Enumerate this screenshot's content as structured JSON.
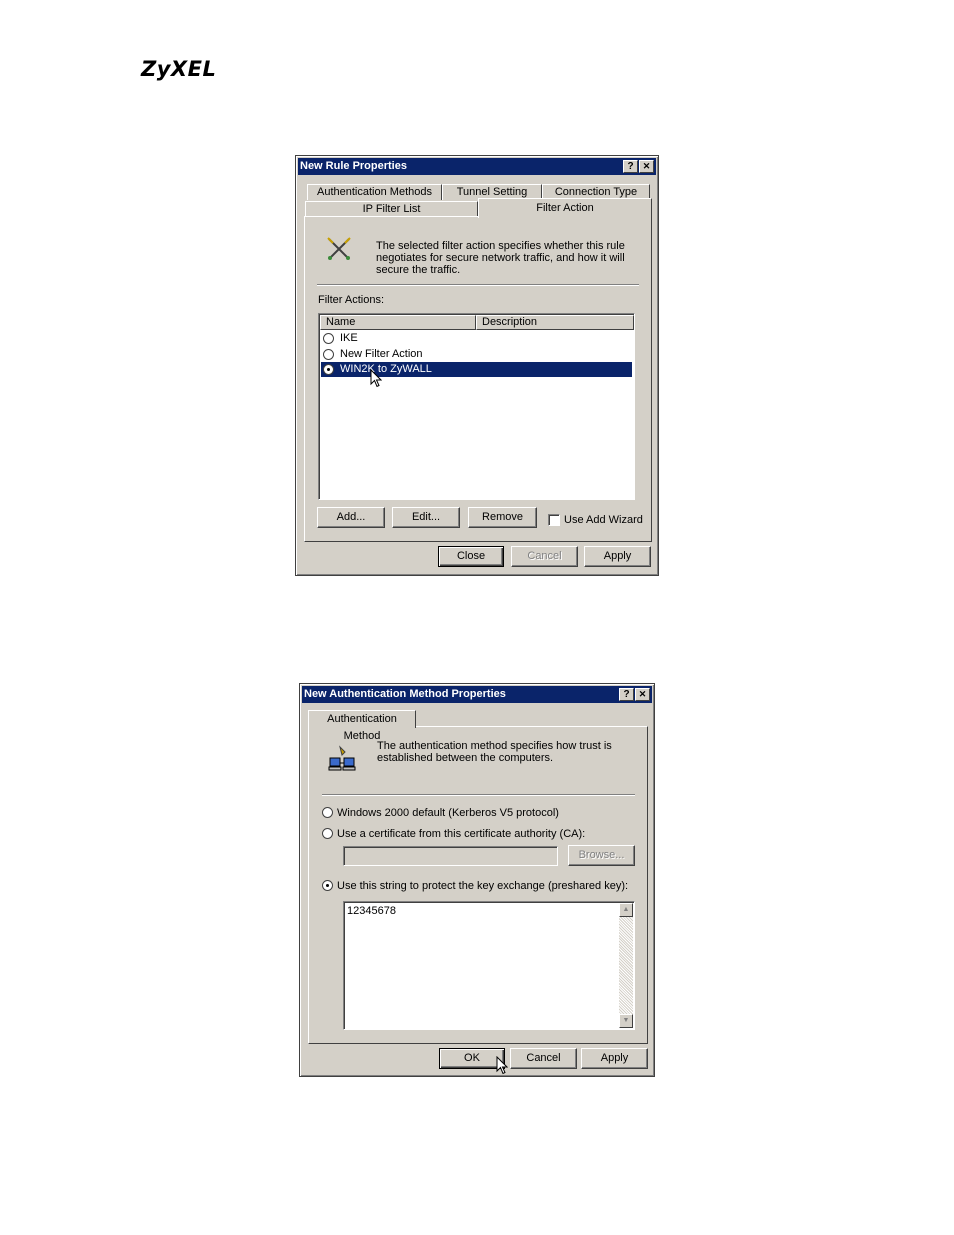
{
  "logo": "ZyXEL",
  "rule_dialog": {
    "title": "New Rule Properties",
    "help_btn": "?",
    "close_btn": "✕",
    "tabs": [
      "Authentication Methods",
      "Tunnel Setting",
      "Connection Type",
      "IP Filter List",
      "Filter Action"
    ],
    "description": "The selected filter action specifies whether this rule negotiates for secure network traffic, and how it will secure the traffic.",
    "filter_actions_label": "Filter Actions:",
    "columns": [
      "Name",
      "Description"
    ],
    "rows": [
      {
        "name": "IKE",
        "selected": false
      },
      {
        "name": "New Filter Action",
        "selected": false
      },
      {
        "name": "WIN2K to ZyWALL",
        "selected": true
      }
    ],
    "add_btn": "Add...",
    "edit_btn": "Edit...",
    "remove_btn": "Remove",
    "wizard_label": "Use Add Wizard",
    "close_button": "Close",
    "cancel_button": "Cancel",
    "apply_button": "Apply"
  },
  "auth_dialog": {
    "title": "New Authentication Method Properties",
    "help_btn": "?",
    "close_btn": "✕",
    "tab": "Authentication Method",
    "description": "The authentication method specifies how trust is established between the computers.",
    "opt_kerberos": "Windows 2000 default (Kerberos V5 protocol)",
    "opt_cert": "Use a certificate from this certificate authority (CA):",
    "browse_btn": "Browse...",
    "opt_psk": "Use this string to protect the key exchange (preshared key):",
    "psk_value": "12345678",
    "ok_button": "OK",
    "cancel_button": "Cancel",
    "apply_button": "Apply"
  }
}
